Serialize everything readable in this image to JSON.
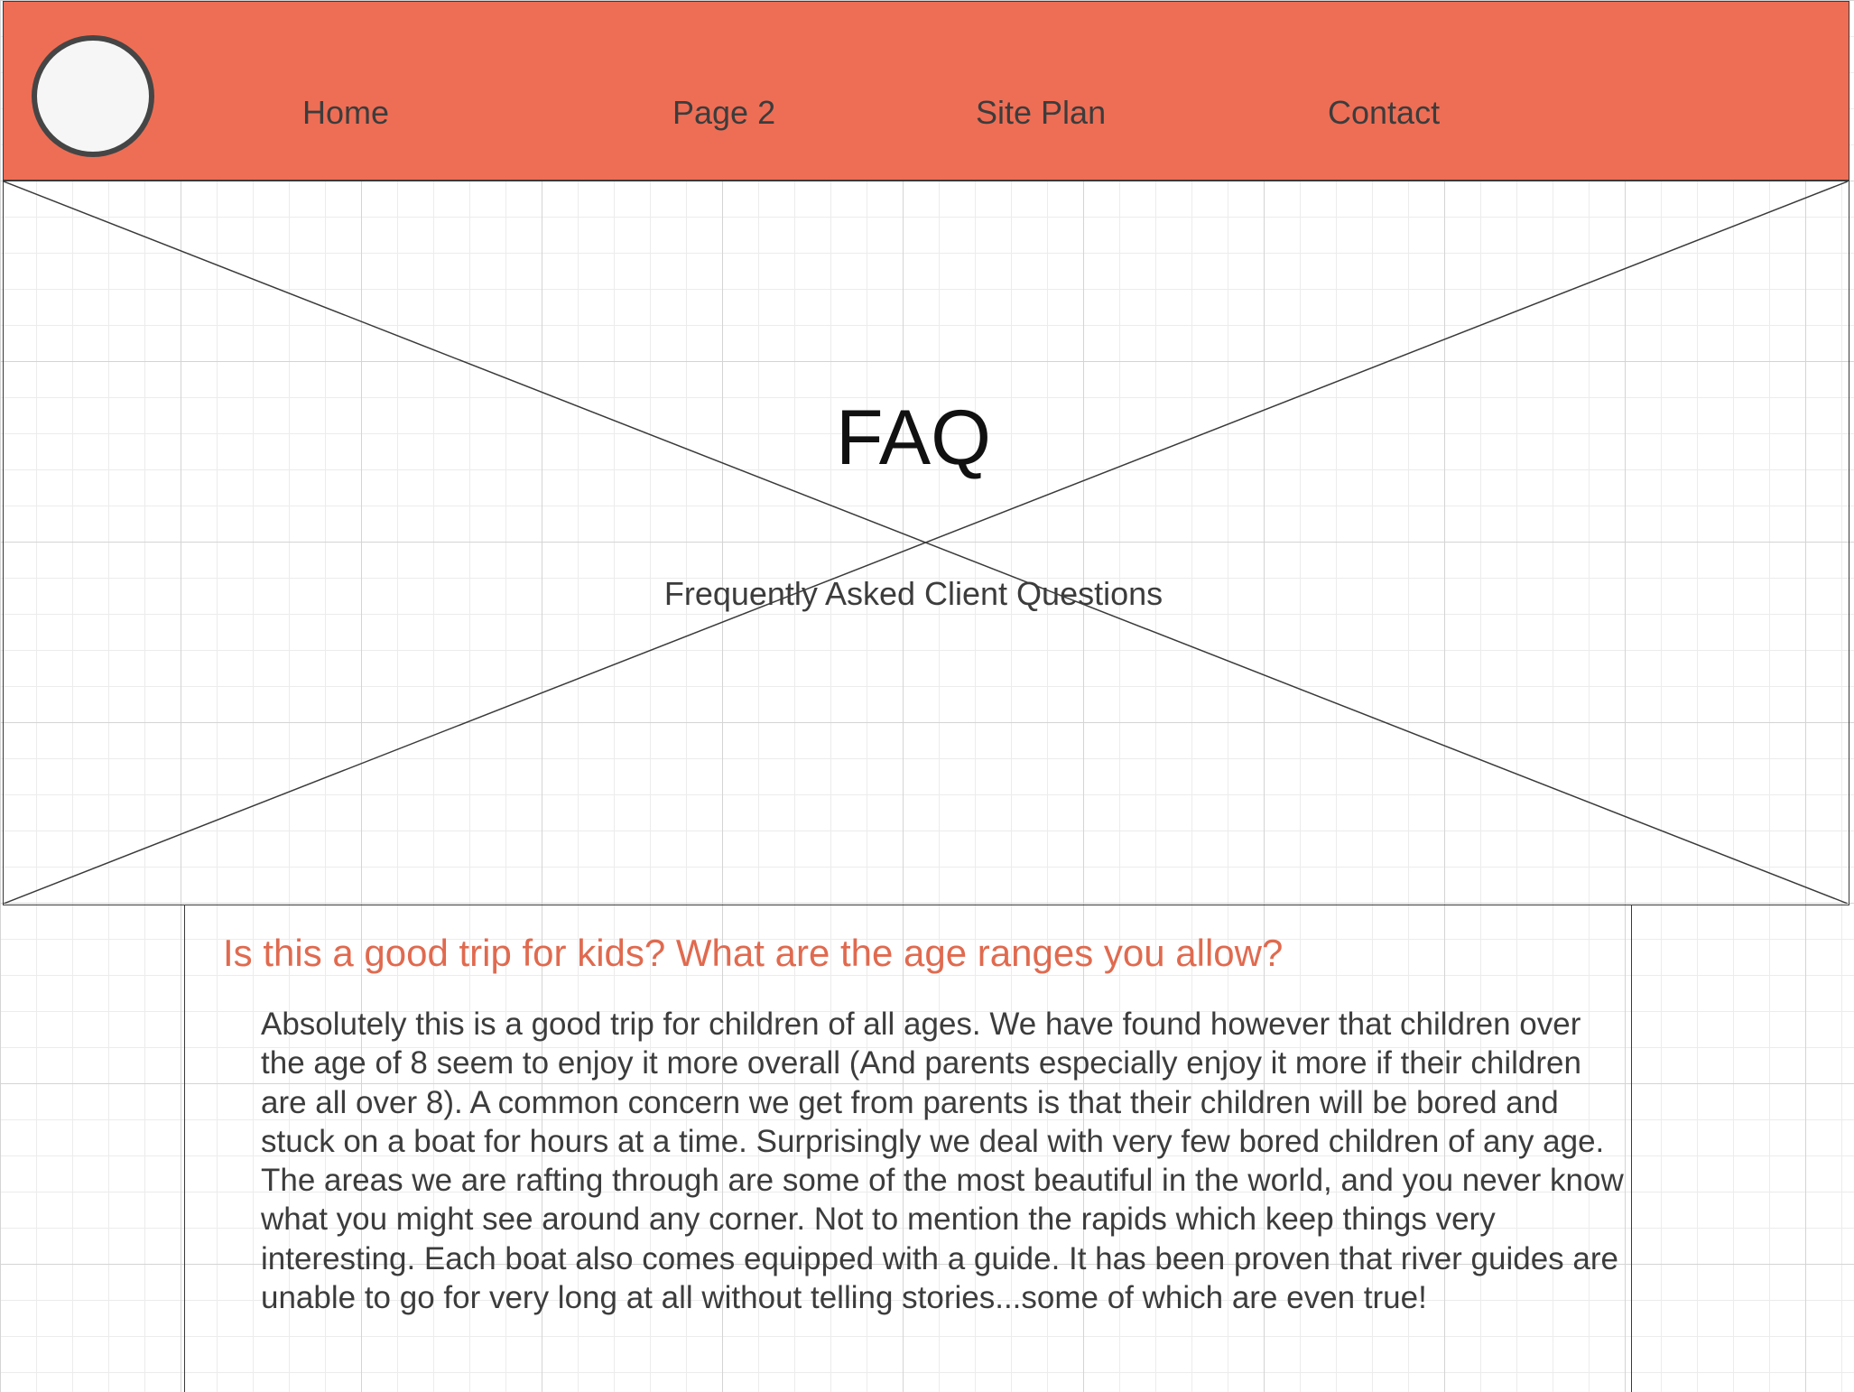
{
  "header": {
    "nav": {
      "home": "Home",
      "page2": "Page 2",
      "site_plan": "Site Plan",
      "contact": "Contact"
    },
    "logo_icon": "circle-logo-placeholder"
  },
  "hero": {
    "title": "FAQ",
    "subtitle": "Frequently Asked Client Questions",
    "image_icon": "image-placeholder-x"
  },
  "faq": {
    "question": "Is this a good trip for kids? What are the age ranges you allow?",
    "answer": "Absolutely this is a good trip for children of all ages. We have found however that children over the age of 8 seem to enjoy it more overall (And parents especially enjoy it more if their children are all over 8). A common concern we get from parents is that their children will be bored and stuck on a boat for hours at a time. Surprisingly we deal with very few bored children of any age. The areas we are rafting through are some of the most beautiful in the world, and you never know what you might see around any corner. Not to mention the rapids which keep things very interesting. Each boat also comes equipped with a guide. It has been proven that river guides are unable to go for very long at all without telling stories...some of which are even true!"
  },
  "colors": {
    "header_bg": "#ee6e55",
    "accent": "#e06a4f",
    "text": "#3c3c3c",
    "border": "#3a3a3a"
  }
}
